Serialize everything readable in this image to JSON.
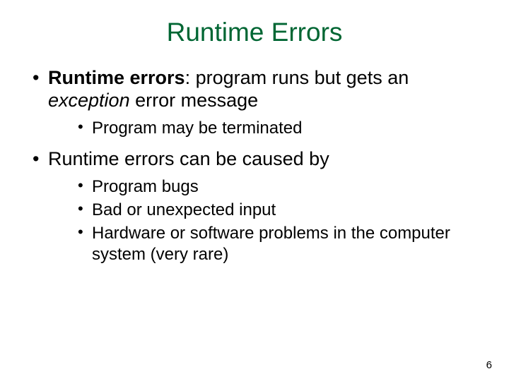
{
  "title": "Runtime Errors",
  "b1": {
    "strong": "Runtime errors",
    "after_colon": ": program runs but gets an ",
    "italic": "exception",
    "tail": " error message",
    "sub1": "Program may be terminated"
  },
  "b2": {
    "text": "Runtime errors can be caused by",
    "sub1": "Program bugs",
    "sub2": "Bad or unexpected input",
    "sub3": "Hardware or software problems in the computer system (very rare)"
  },
  "page_number": "6"
}
